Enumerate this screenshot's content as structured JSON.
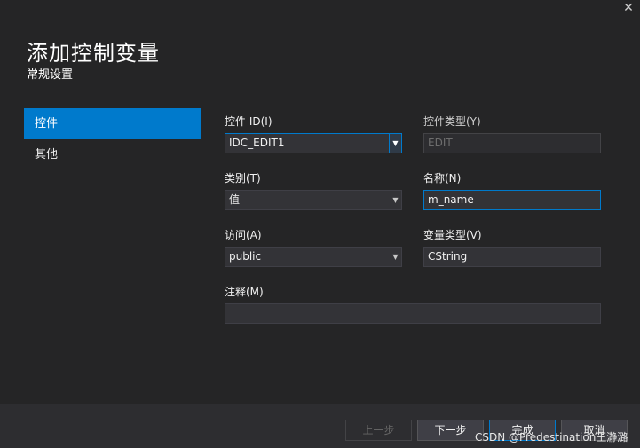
{
  "dialog": {
    "close_glyph": "✕",
    "title": "添加控制变量",
    "subtitle": "常规设置"
  },
  "nav": {
    "items": [
      {
        "label": "控件",
        "selected": true
      },
      {
        "label": "其他",
        "selected": false
      }
    ]
  },
  "form": {
    "control_id": {
      "label": "控件 ID(I)",
      "value": "IDC_EDIT1"
    },
    "control_type": {
      "label": "控件类型(Y)",
      "value": "EDIT"
    },
    "category": {
      "label": "类别(T)",
      "value": "值"
    },
    "name": {
      "label": "名称(N)",
      "value": "m_name"
    },
    "access": {
      "label": "访问(A)",
      "value": "public"
    },
    "variable_type": {
      "label": "变量类型(V)",
      "value": "CString"
    },
    "comment": {
      "label": "注释(M)",
      "value": ""
    }
  },
  "footer": {
    "prev_label": "上一步",
    "next_label": "下一步",
    "finish_label": "完成",
    "cancel_label": "取消"
  },
  "watermark": "CSDN @Predestination王瀞潞",
  "icons": {
    "dropdown": "dropdown-arrow-icon",
    "close": "close-icon"
  },
  "colors": {
    "background": "#252526",
    "accent": "#007acc",
    "footer": "#2d2d30"
  }
}
